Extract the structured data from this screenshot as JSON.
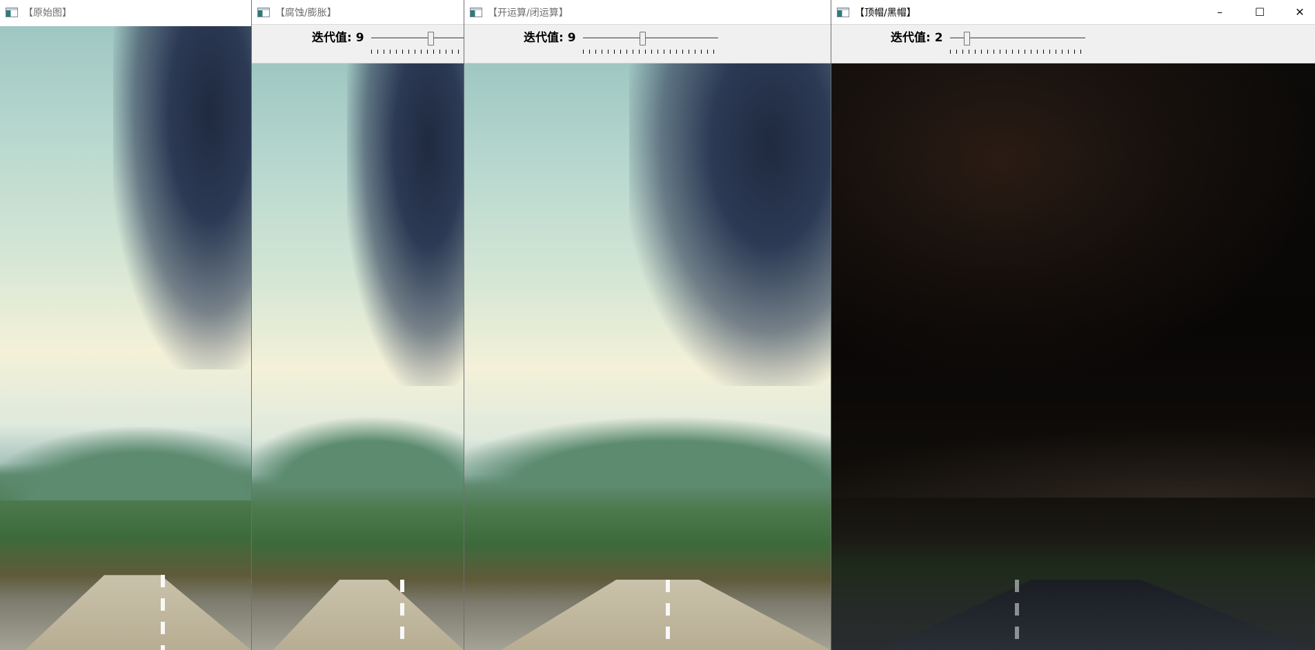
{
  "windows": [
    {
      "title": "【原始图】",
      "active": false
    },
    {
      "title": "【腐蚀/膨胀】",
      "active": false,
      "trackbar": {
        "label": "迭代值: 9",
        "value": 9
      }
    },
    {
      "title": "【开运算/闭运算】",
      "active": false,
      "trackbar": {
        "label": "迭代值: 9",
        "value": 9
      }
    },
    {
      "title": "【顶帽/黑帽】",
      "active": true,
      "trackbar": {
        "label": "迭代值: 2",
        "value": 2
      }
    }
  ],
  "window_controls": {
    "minimize": "–",
    "maximize": "☐",
    "close": "✕"
  }
}
